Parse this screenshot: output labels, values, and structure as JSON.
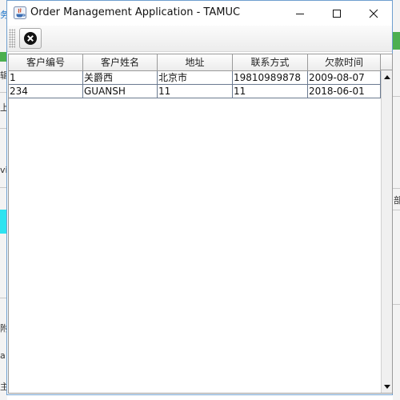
{
  "window": {
    "title": "Order Management Application - TAMUC"
  },
  "toolbar": {
    "exit_button_icon": "close-circle-icon"
  },
  "table": {
    "columns": [
      "客户编号",
      "客户姓名",
      "地址",
      "联系方式",
      "欠款时间"
    ],
    "rows": [
      [
        "1",
        "关爵西",
        "北京市",
        "19810989878",
        "2009-08-07"
      ],
      [
        "234",
        "GUANSH",
        "11",
        "11",
        "2018-06-01"
      ]
    ]
  },
  "background_fragments": {
    "left": [
      "务",
      "辑",
      "上",
      "vi",
      "附",
      "a",
      "主"
    ],
    "right": [
      "部"
    ]
  }
}
